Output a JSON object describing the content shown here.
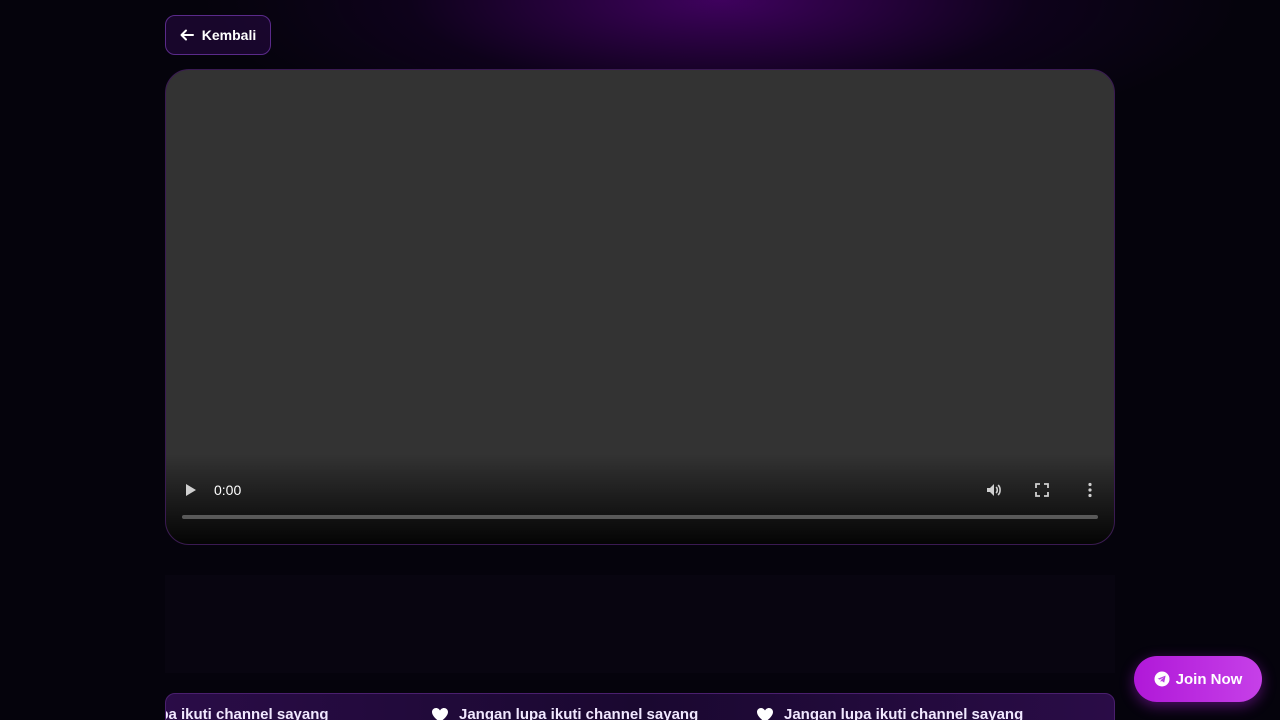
{
  "header": {
    "back_label": "Kembali"
  },
  "video": {
    "current_time": "0:00",
    "progress": 0
  },
  "marquee": {
    "items": [
      "ngan lupa ikuti channel sayang",
      "Jangan lupa ikuti channel sayang",
      "Jangan lupa ikuti channel sayang"
    ]
  },
  "cta": {
    "join_label": "Join Now"
  },
  "colors": {
    "accent": "#b018d8",
    "background": "#05030c",
    "video_surface": "#333333"
  },
  "icons": {
    "back": "arrow-left-icon",
    "play": "play-icon",
    "volume": "volume-icon",
    "fullscreen": "fullscreen-icon",
    "more": "more-vertical-icon",
    "marquee": "heart-icon",
    "join": "telegram-icon"
  }
}
